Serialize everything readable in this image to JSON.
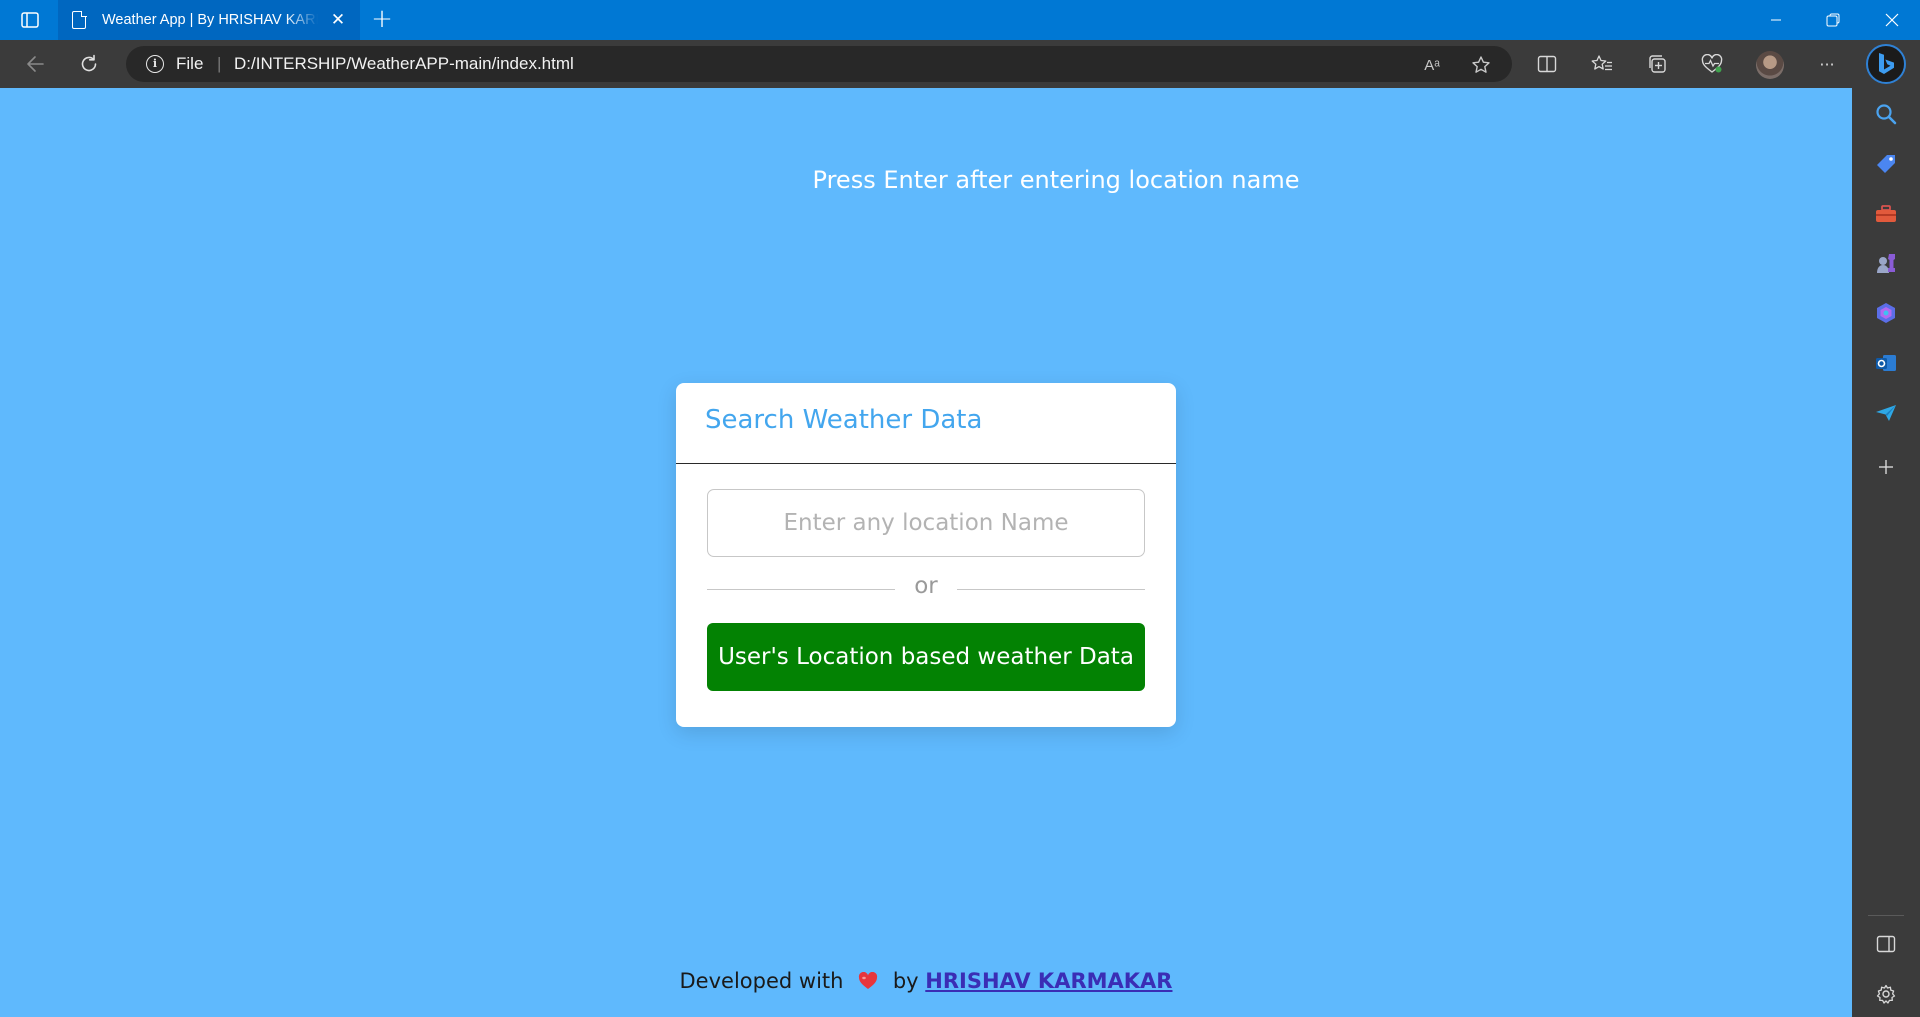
{
  "browser": {
    "tab_title": "Weather App | By HRISHAV KARMAKAR",
    "address_scheme_label": "File",
    "address_url": "D:/INTERSHIP/WeatherAPP-main/index.html",
    "read_aloud_label": "Aᵃ",
    "more_label": "···"
  },
  "page": {
    "hint_text": "Press Enter after entering location name",
    "card_title": "Search Weather Data",
    "location_placeholder": "Enter any location Name",
    "or_text": "or",
    "user_location_button": "User's Location based weather Data",
    "footer_prefix": "Developed with",
    "footer_by": "by",
    "footer_author": "HRISHAV KARMAKAR"
  },
  "colors": {
    "page_background": "#5fb9fd",
    "title_bar": "#0078d4",
    "card_title": "#43a6ee",
    "button_green": "#038203",
    "author_link": "#3a2db5"
  },
  "icons": {
    "sidebar": [
      "search-icon",
      "shopping-tag-icon",
      "tools-icon",
      "games-icon",
      "copilot-icon",
      "outlook-icon",
      "send-icon",
      "add-icon"
    ]
  }
}
